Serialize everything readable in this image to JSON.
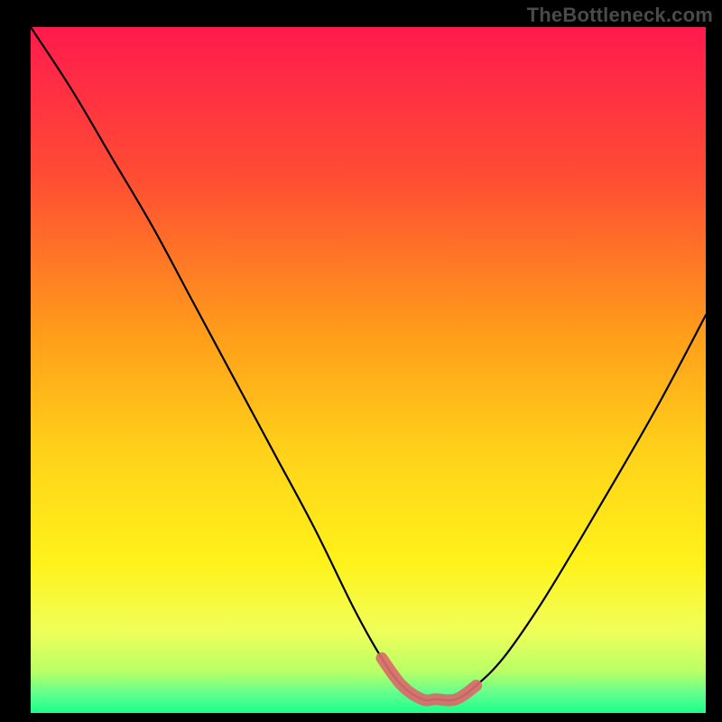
{
  "watermark": "TheBottleneck.com",
  "chart_data": {
    "type": "line",
    "title": "",
    "xlabel": "",
    "ylabel": "",
    "xlim": [
      0,
      100
    ],
    "ylim": [
      0,
      100
    ],
    "grid": false,
    "legend": false,
    "series": [
      {
        "name": "curve",
        "x": [
          0,
          6,
          12,
          18,
          24,
          30,
          36,
          42,
          48,
          52,
          55,
          58,
          60,
          63,
          66,
          70,
          75,
          80,
          86,
          93,
          100
        ],
        "y": [
          100,
          91,
          81,
          71,
          60,
          49,
          38,
          27,
          15,
          8,
          4,
          2,
          2,
          2,
          4,
          8,
          15,
          23,
          33,
          45,
          58
        ]
      }
    ],
    "highlight": {
      "name": "optimal-zone",
      "x": [
        52,
        55,
        58,
        60,
        63,
        66
      ],
      "y": [
        8,
        4,
        2,
        2,
        2,
        4
      ],
      "color": "#d96b6b"
    },
    "gradient_stops": [
      {
        "offset": 0.0,
        "color": "#ff1a4d"
      },
      {
        "offset": 0.22,
        "color": "#ff4d33"
      },
      {
        "offset": 0.45,
        "color": "#ff9e1a"
      },
      {
        "offset": 0.62,
        "color": "#ffd21a"
      },
      {
        "offset": 0.78,
        "color": "#fff21a"
      },
      {
        "offset": 0.88,
        "color": "#f0ff59"
      },
      {
        "offset": 0.94,
        "color": "#b8ff66"
      },
      {
        "offset": 0.97,
        "color": "#66ff8c"
      },
      {
        "offset": 1.0,
        "color": "#1aff8c"
      }
    ]
  }
}
